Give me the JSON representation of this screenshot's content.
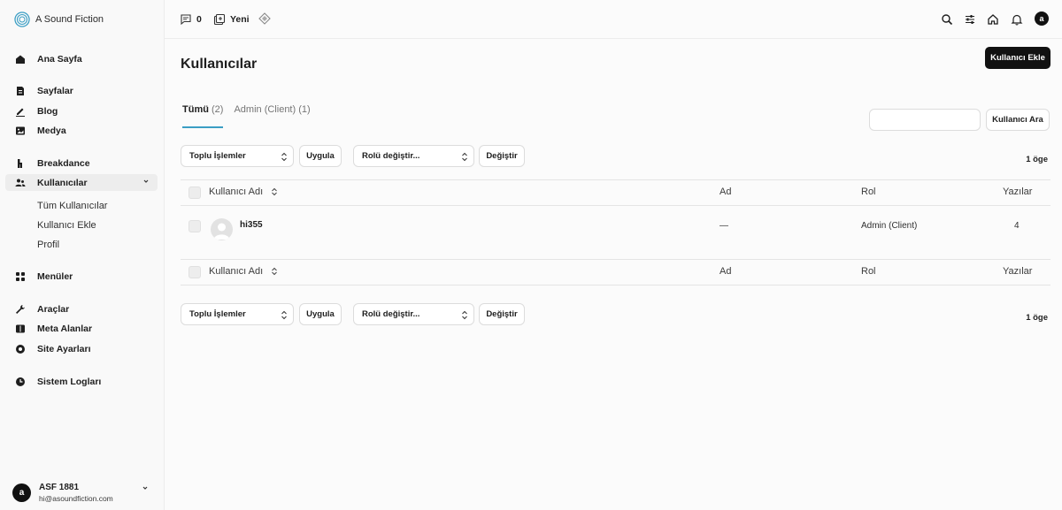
{
  "brand": {
    "name": "A Sound Fiction"
  },
  "sidebar": {
    "items": [
      {
        "label": "Ana Sayfa"
      },
      {
        "label": "Sayfalar"
      },
      {
        "label": "Blog"
      },
      {
        "label": "Medya"
      },
      {
        "label": "Breakdance"
      },
      {
        "label": "Kullanıcılar"
      },
      {
        "label": "Menüler"
      },
      {
        "label": "Araçlar"
      },
      {
        "label": "Meta Alanlar"
      },
      {
        "label": "Site Ayarları"
      },
      {
        "label": "Sistem Logları"
      }
    ],
    "subitems": [
      {
        "label": "Tüm Kullanıcılar"
      },
      {
        "label": "Kullanıcı Ekle"
      },
      {
        "label": "Profil"
      }
    ],
    "user": {
      "initial": "a",
      "name": "ASF 1881",
      "email": "hi@asoundfiction.com"
    }
  },
  "topbar": {
    "comments_count": "0",
    "new_label": "Yeni",
    "avatar_initial": "a"
  },
  "main": {
    "title": "Kullanıcılar",
    "add_button": "Kullanıcı Ekle",
    "tabs": [
      {
        "label": "Tümü",
        "count": "(2)"
      },
      {
        "label": "Admin (Client)",
        "count": "(1)"
      }
    ],
    "search": {
      "value": "",
      "button": "Kullanıcı Ara"
    },
    "bulk_top": {
      "bulk_select": "Toplu İşlemler",
      "apply": "Uygula",
      "role_select": "Rolü değiştir...",
      "change": "Değiştir",
      "count": "1 öge"
    },
    "bulk_bottom": {
      "bulk_select": "Toplu İşlemler",
      "apply": "Uygula",
      "role_select": "Rolü değiştir...",
      "change": "Değiştir",
      "count": "1 öge"
    },
    "table": {
      "columns": [
        "Kullanıcı Adı",
        "Ad",
        "Rol",
        "Yazılar"
      ],
      "rows": [
        {
          "username": "hi355",
          "name": "—",
          "role": "Admin (Client)",
          "posts": "4"
        }
      ]
    }
  },
  "colors": {
    "accent": "#3b9ec4",
    "primary_button": "#111111"
  }
}
